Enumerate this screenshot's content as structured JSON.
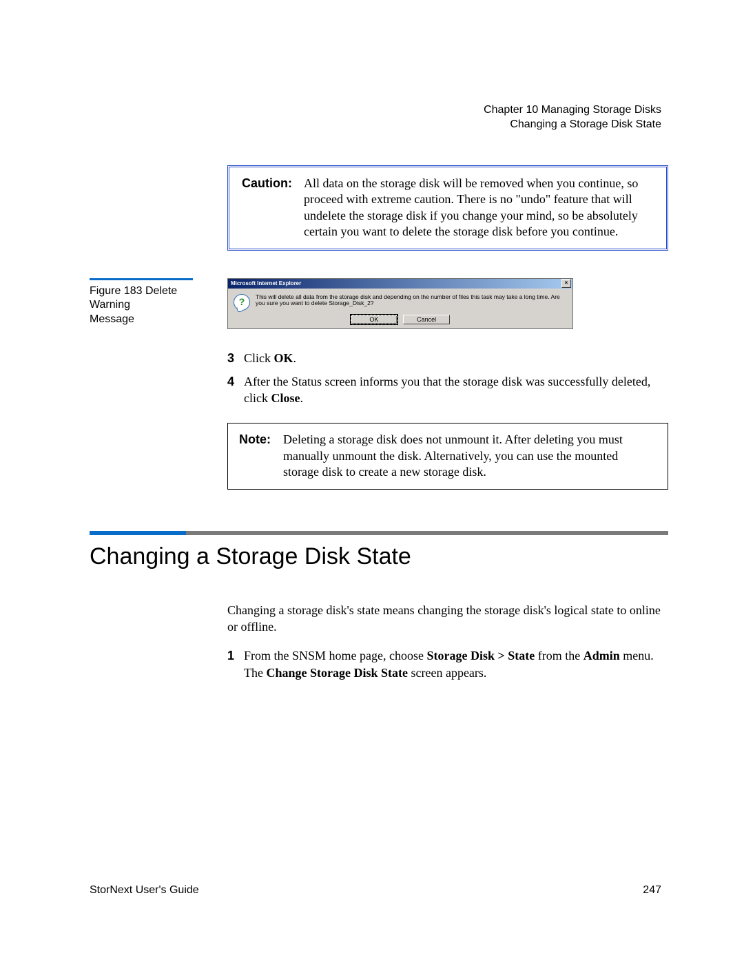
{
  "header": {
    "chapter": "Chapter 10  Managing Storage Disks",
    "section": "Changing a Storage Disk State"
  },
  "caution": {
    "label": "Caution:",
    "text": "All data on the storage disk will be removed when you continue, so proceed with extreme caution. There is no \"undo\" feature that will undelete the storage disk if you change your mind, so be absolutely certain you want to delete the storage disk before you continue."
  },
  "figure": {
    "label_line1": "Figure 183  Delete Warning",
    "label_line2": "Message"
  },
  "dialog": {
    "title": "Microsoft Internet Explorer",
    "close_glyph": "×",
    "icon_glyph": "?",
    "message": "This will delete all data from the storage disk and depending on the number of files this task may take a long time.  Are you sure you want to delete Storage_Disk_2?",
    "ok_label": "OK",
    "cancel_label": "Cancel"
  },
  "steps": [
    {
      "num": "3",
      "text_prefix": "Click ",
      "bold": "OK",
      "text_suffix": "."
    },
    {
      "num": "4",
      "text_prefix": "After the Status screen informs you that the storage disk was successfully deleted, click ",
      "bold": "Close",
      "text_suffix": "."
    }
  ],
  "note": {
    "label": "Note:",
    "text": "Deleting a storage disk does not unmount it. After deleting you must manually unmount the disk. Alternatively, you can use the mounted storage disk to create a new storage disk."
  },
  "section": {
    "title": "Changing a Storage Disk State",
    "intro": "Changing a storage disk's state means changing the storage disk's logical state to online or offline.",
    "step_num": "1",
    "step_pre": "From the SNSM home page, choose ",
    "step_bold1": "Storage Disk > State",
    "step_mid": " from the ",
    "step_bold2": "Admin",
    "step_mid2": " menu. The ",
    "step_bold3": "Change Storage Disk State",
    "step_post": " screen appears."
  },
  "footer": {
    "left": "StorNext User's Guide",
    "right": "247"
  }
}
